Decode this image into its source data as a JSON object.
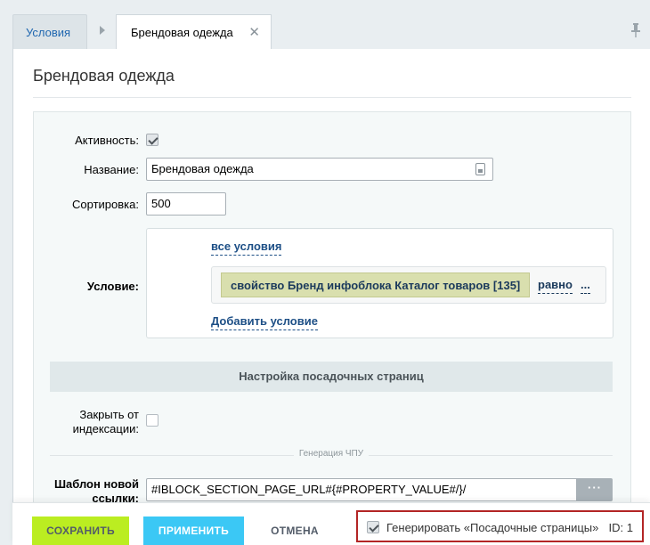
{
  "tabs": {
    "conditions_label": "Условия",
    "active_label": "Брендовая одежда",
    "close_glyph": "✕"
  },
  "page_title": "Брендовая одежда",
  "form": {
    "active_label": "Активность:",
    "active_checked": true,
    "name_label": "Название:",
    "name_value": "Брендовая одежда",
    "sort_label": "Сортировка:",
    "sort_value": "500",
    "condition_label": "Условие:",
    "condition": {
      "all_conditions_link": "все условия",
      "property_text": "свойство Бренд инфоблока Каталог товаров [135]",
      "operator_text": "равно",
      "more_text": "...",
      "add_condition_link": "Добавить условие"
    },
    "landing_section_title": "Настройка посадочных страниц",
    "noindex_label_line1": "Закрыть от",
    "noindex_label_line2": "индексации:",
    "noindex_checked": false,
    "sef_section_title": "Генерация ЧПУ",
    "url_template_label_line1": "Шаблон новой",
    "url_template_label_line2": "ссылки:",
    "url_template_value": "#IBLOCK_SECTION_PAGE_URL#{#PROPERTY_VALUE#/}/",
    "dots_button": "···"
  },
  "footer": {
    "save_label": "СОХРАНИТЬ",
    "apply_label": "ПРИМЕНИТЬ",
    "cancel_label": "ОТМЕНА",
    "generate_label": "Генерировать «Посадочные страницы»",
    "generate_checked": true,
    "id_text": "ID: 1"
  },
  "colors": {
    "save_button": "#bbed21",
    "apply_button": "#3bc8f5",
    "highlight_border": "#b32525",
    "condition_chip": "#d9dfae",
    "link_blue": "#1d4f86"
  }
}
